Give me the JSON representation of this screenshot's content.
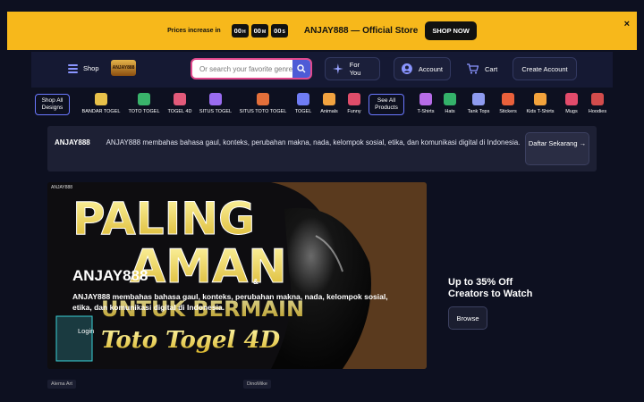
{
  "banner": {
    "prices_label": "Prices increase in",
    "timer": [
      {
        "value": "00",
        "unit": "H"
      },
      {
        "value": "00",
        "unit": "M"
      },
      {
        "value": "00",
        "unit": "S"
      }
    ],
    "store_text": "ANJAY888 — Official Store",
    "shop_now": "SHOP NOW",
    "close": "×",
    "bg_color": "#f7b81b"
  },
  "header": {
    "shop_label": "Shop",
    "logo_text": "ANJAY888",
    "search_placeholder": "Or search your favorite genre",
    "for_you": "For You",
    "account": "Account",
    "cart": "Cart",
    "create_account": "Create Account"
  },
  "categories": {
    "shop_all": "Shop All Designs",
    "see_all": "See All Products",
    "items": [
      {
        "label": "BANDAR TOGEL",
        "color": "#e8c14a"
      },
      {
        "label": "TOTO TOGEL",
        "color": "#39b36b"
      },
      {
        "label": "TOGEL 4D",
        "color": "#e25a7a"
      },
      {
        "label": "SITUS TOGEL",
        "color": "#9a6cf0"
      },
      {
        "label": "SITUS TOTO TOGEL",
        "color": "#e36f3a"
      },
      {
        "label": "TOGEL",
        "color": "#6f7cf5"
      },
      {
        "label": "Animals",
        "color": "#f2a340"
      },
      {
        "label": "Funny",
        "color": "#e04d6a"
      }
    ],
    "products": [
      {
        "label": "T-Shirts",
        "color": "#b76ce8"
      },
      {
        "label": "Hats",
        "color": "#34b26a"
      },
      {
        "label": "Tank Tops",
        "color": "#8e9bf0"
      },
      {
        "label": "Stickers",
        "color": "#e9603b"
      },
      {
        "label": "Kids T-Shirts",
        "color": "#f3a33c"
      },
      {
        "label": "Mugs",
        "color": "#e24b6b"
      },
      {
        "label": "Hoodies",
        "color": "#d34c4c"
      }
    ]
  },
  "intro": {
    "brand": "ANJAY888",
    "description": "ANJAY888 membahas bahasa gaul, konteks, perubahan makna, nada, kelompok sosial, etika, dan komunikasi digital di Indonesia.",
    "cta": "Daftar Sekarang →"
  },
  "hero": {
    "tag": "ANJAY888",
    "image_line1": "PALING",
    "image_line2": "AMAN",
    "image_line3": "UNTUK BERMAIN",
    "image_script": "Toto Togel 4D",
    "title": "ANJAY888",
    "amp": "&",
    "description": "ANJAY888 membahas bahasa gaul, konteks, perubahan makna, nada, kelompok sosial, etika, dan komunikasi digital di Indonesia.",
    "login": "Login"
  },
  "promo": {
    "title": "Up to 35% Off Creators to Watch",
    "browse": "Browse"
  },
  "artists": [
    "Alema Art",
    "DinoMike"
  ]
}
